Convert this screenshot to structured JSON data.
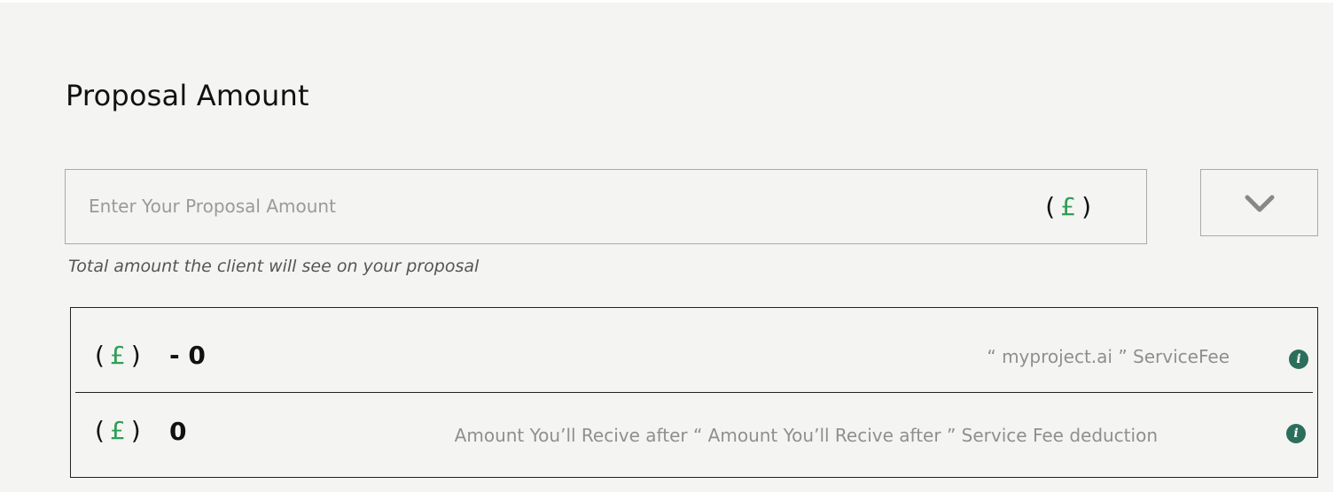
{
  "section": {
    "title": "Proposal Amount"
  },
  "amount_field": {
    "value": "",
    "placeholder": "Enter Your Proposal Amount",
    "currency_open": "(",
    "currency_symbol": "£",
    "currency_close": ")",
    "helper_text": "Total amount the client will see on your proposal"
  },
  "dropdown": {
    "icon": "chevron-down-icon"
  },
  "summary": {
    "fee_row": {
      "currency_open": "(",
      "currency_symbol": "£",
      "currency_close": ")",
      "value": "- 0",
      "description": "“ myproject.ai ” ServiceFee",
      "info_glyph": "i"
    },
    "receive_row": {
      "currency_open": "(",
      "currency_symbol": "£",
      "currency_close": ")",
      "value": "0",
      "description": "Amount You’ll Recive after “ Amount You’ll Recive after ” Service Fee deduction",
      "info_glyph": "i"
    }
  },
  "colors": {
    "panel_background": "#f4f4f2",
    "currency_symbol": "#2e9e55",
    "info_icon": "#2b6e5b"
  }
}
